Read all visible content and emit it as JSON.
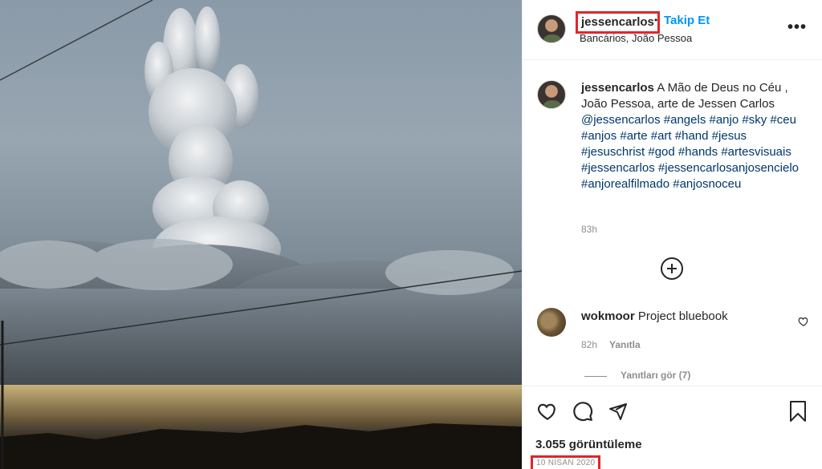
{
  "post": {
    "username": "jessencarlos",
    "separator": "•",
    "follow_label": "Takip Et",
    "location": "Bancários, João Pessoa",
    "more_icon": "more-options-icon"
  },
  "caption": {
    "username": "jessencarlos",
    "text": "A Mão de Deus no Céu , João Pessoa, arte de Jessen Carlos",
    "tags": [
      "@jessencarlos",
      "#angels",
      "#anjo",
      "#sky",
      "#ceu",
      "#anjos",
      "#arte",
      "#art",
      "#hand",
      "#jesus",
      "#jesuschrist",
      "#god",
      "#hands",
      "#artesvisuais",
      "#jessencarlos",
      "#jessencarlosanjosencielo",
      "#anjorealfilmado",
      "#anjosnoceu"
    ],
    "time": "83h"
  },
  "comment": {
    "username": "wokmoor",
    "text": "Project bluebook",
    "time": "82h",
    "reply_label": "Yanıtla",
    "view_replies_label": "Yanıtları gör (7)"
  },
  "footer": {
    "views": "3.055 görüntüleme",
    "date": "10 NİSAN 2020"
  },
  "colors": {
    "link_blue": "#0095f6",
    "hashtag": "#00376b",
    "highlight_box": "#e0262b",
    "muted": "#8e8e8e"
  }
}
